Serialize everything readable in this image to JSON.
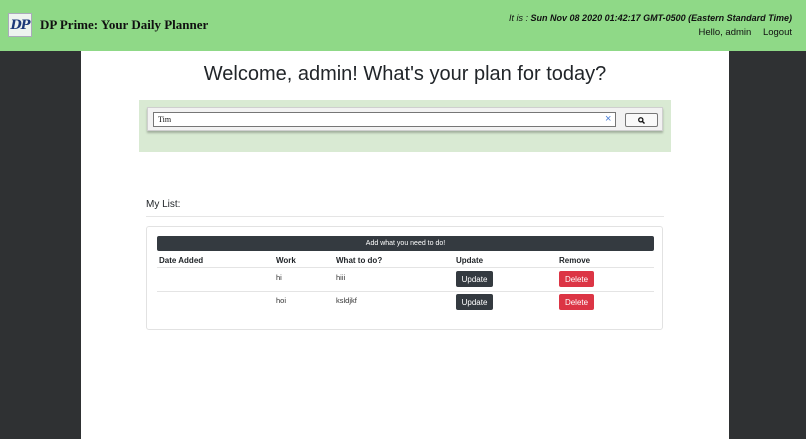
{
  "header": {
    "logo_text": "DP",
    "brand": "DP Prime: Your Daily Planner",
    "time_prefix": "It is : ",
    "time_value": "Sun Nov 08 2020 01:42:17 GMT-0500 (Eastern Standard Time)",
    "greeting": "Hello, admin",
    "logout": "Logout"
  },
  "main": {
    "welcome": "Welcome, admin! What's your plan for today?",
    "search": {
      "value": "Tim",
      "clear_icon": "×"
    },
    "list_title": "My List:",
    "add_button": "Add what you need to do!",
    "columns": [
      "Date Added",
      "Work",
      "What to do?",
      "Update",
      "Remove"
    ],
    "rows": [
      {
        "date": "",
        "work": "hi",
        "todo": "hiii",
        "update": "Update",
        "remove": "Delete"
      },
      {
        "date": "",
        "work": "hoi",
        "todo": "ksldjkf",
        "update": "Update",
        "remove": "Delete"
      }
    ]
  },
  "colors": {
    "header_bg": "#8fd987",
    "page_bg": "#2f3133",
    "search_panel_bg": "#d9ead3",
    "dark_button": "#343a40",
    "danger_button": "#dc3545"
  }
}
